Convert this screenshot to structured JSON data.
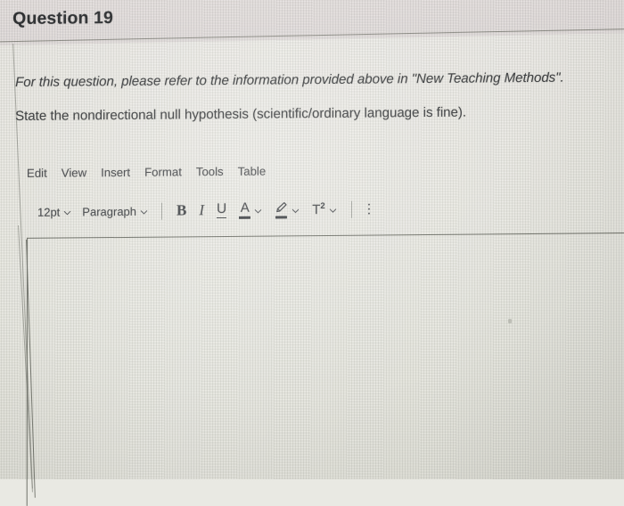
{
  "header": {
    "title": "Question 19"
  },
  "question": {
    "line1": "For this question, please refer to the information provided above in \"New Teaching Methods\".",
    "line2": "State the nondirectional null hypothesis (scientific/ordinary language is fine)."
  },
  "editor": {
    "menubar": [
      {
        "label": "Edit"
      },
      {
        "label": "View"
      },
      {
        "label": "Insert"
      },
      {
        "label": "Format"
      },
      {
        "label": "Tools"
      },
      {
        "label": "Table"
      }
    ],
    "toolbar": {
      "font_size": "12pt",
      "block_format": "Paragraph",
      "bold": "B",
      "italic": "I",
      "underline": "U",
      "text_color": "A",
      "highlight_color": "highlighter-icon",
      "superscript_t": "T",
      "superscript_exp": "2",
      "more_label": "kebab-menu-icon",
      "chevron": "chevron-down-icon"
    },
    "content": "",
    "placeholder": ""
  },
  "colors": {
    "page_background": "#e9e9e3",
    "header_background": "#e4dfde",
    "text": "#3a3c3e",
    "title_text": "#2f3134",
    "rule": "#77776f",
    "editor_border": "#6f7169",
    "toolbar_icon": "#3f4246"
  }
}
